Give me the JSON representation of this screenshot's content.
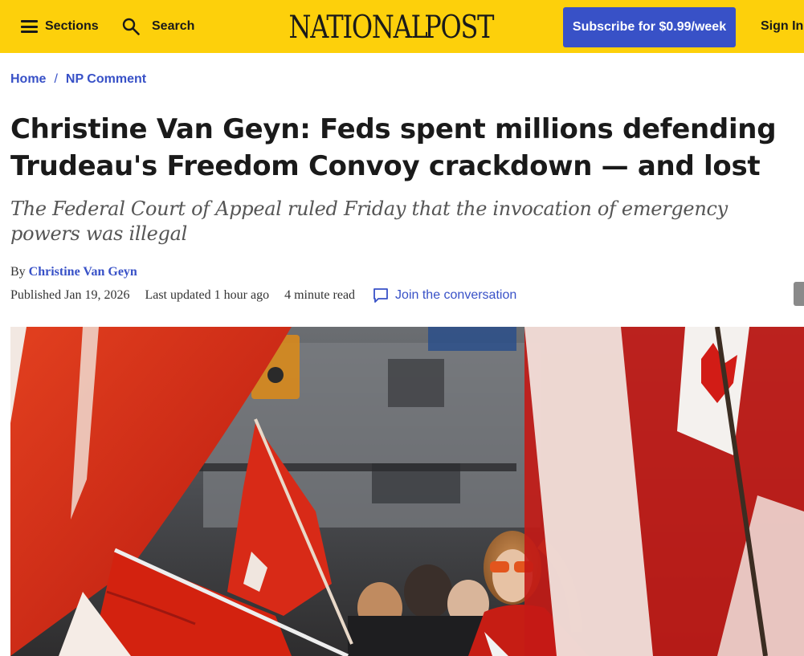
{
  "header": {
    "sections_label": "Sections",
    "search_label": "Search",
    "logo_left": "NATIONAL",
    "logo_right": "POST",
    "subscribe_label": "Subscribe for $0.99/week",
    "signin_label": "Sign In"
  },
  "breadcrumb": {
    "items": [
      "Home",
      "NP Comment"
    ],
    "separator": "/"
  },
  "article": {
    "headline": "Christine Van Geyn: Feds spent millions defending Trudeau's Freedom Convoy crackdown — and lost",
    "deck": "The Federal Court of Appeal ruled Friday that the invocation of emergency powers was illegal",
    "byline_prefix": "By",
    "author": "Christine Van Geyn",
    "published": "Published Jan 19, 2026",
    "updated": "Last updated 1 hour ago",
    "read_time": "4 minute read",
    "conversation_label": "Join the conversation"
  },
  "icons": {
    "menu": "hamburger-menu-icon",
    "search": "search-icon",
    "logo_mark": "maple-leaf-icon",
    "comment": "comment-bubble-icon"
  },
  "colors": {
    "header_bg": "#fdd00b",
    "accent_blue": "#3851c7",
    "text_dark": "#1a1a1a",
    "deck_gray": "#555555",
    "flag_red": "#d9261c"
  }
}
